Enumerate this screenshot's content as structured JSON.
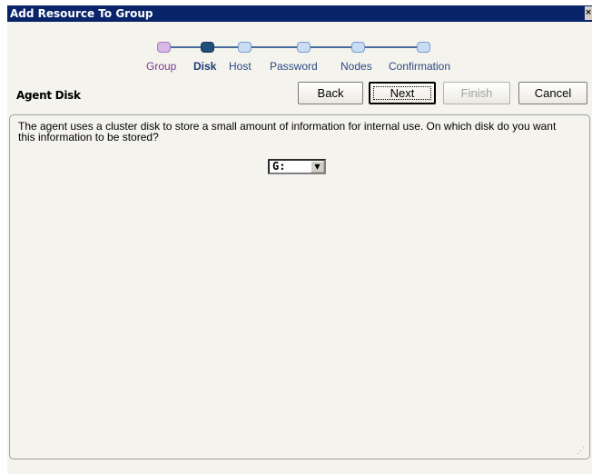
{
  "window": {
    "title": "Add Resource To Group",
    "close_glyph": "×"
  },
  "wizard": {
    "steps": [
      {
        "label": "Group",
        "state": "done",
        "color": "#d9b8e8"
      },
      {
        "label": "Disk",
        "state": "active",
        "color": "#1f4e79"
      },
      {
        "label": "Host",
        "state": "pending",
        "color": "#c8dcf4"
      },
      {
        "label": "Password",
        "state": "pending",
        "color": "#c8dcf4"
      },
      {
        "label": "Nodes",
        "state": "pending",
        "color": "#c8dcf4"
      },
      {
        "label": "Confirmation",
        "state": "pending",
        "color": "#c8dcf4"
      }
    ]
  },
  "page": {
    "title": "Agent Disk"
  },
  "buttons": {
    "back": "Back",
    "next": "Next",
    "finish": "Finish",
    "cancel": "Cancel"
  },
  "content": {
    "description": "The agent uses a cluster disk to store a small amount of information for internal use.  On which disk do you want this information to be stored?",
    "disk_select": {
      "value": "G:",
      "arrow_icon": "chevron-down-icon"
    }
  }
}
